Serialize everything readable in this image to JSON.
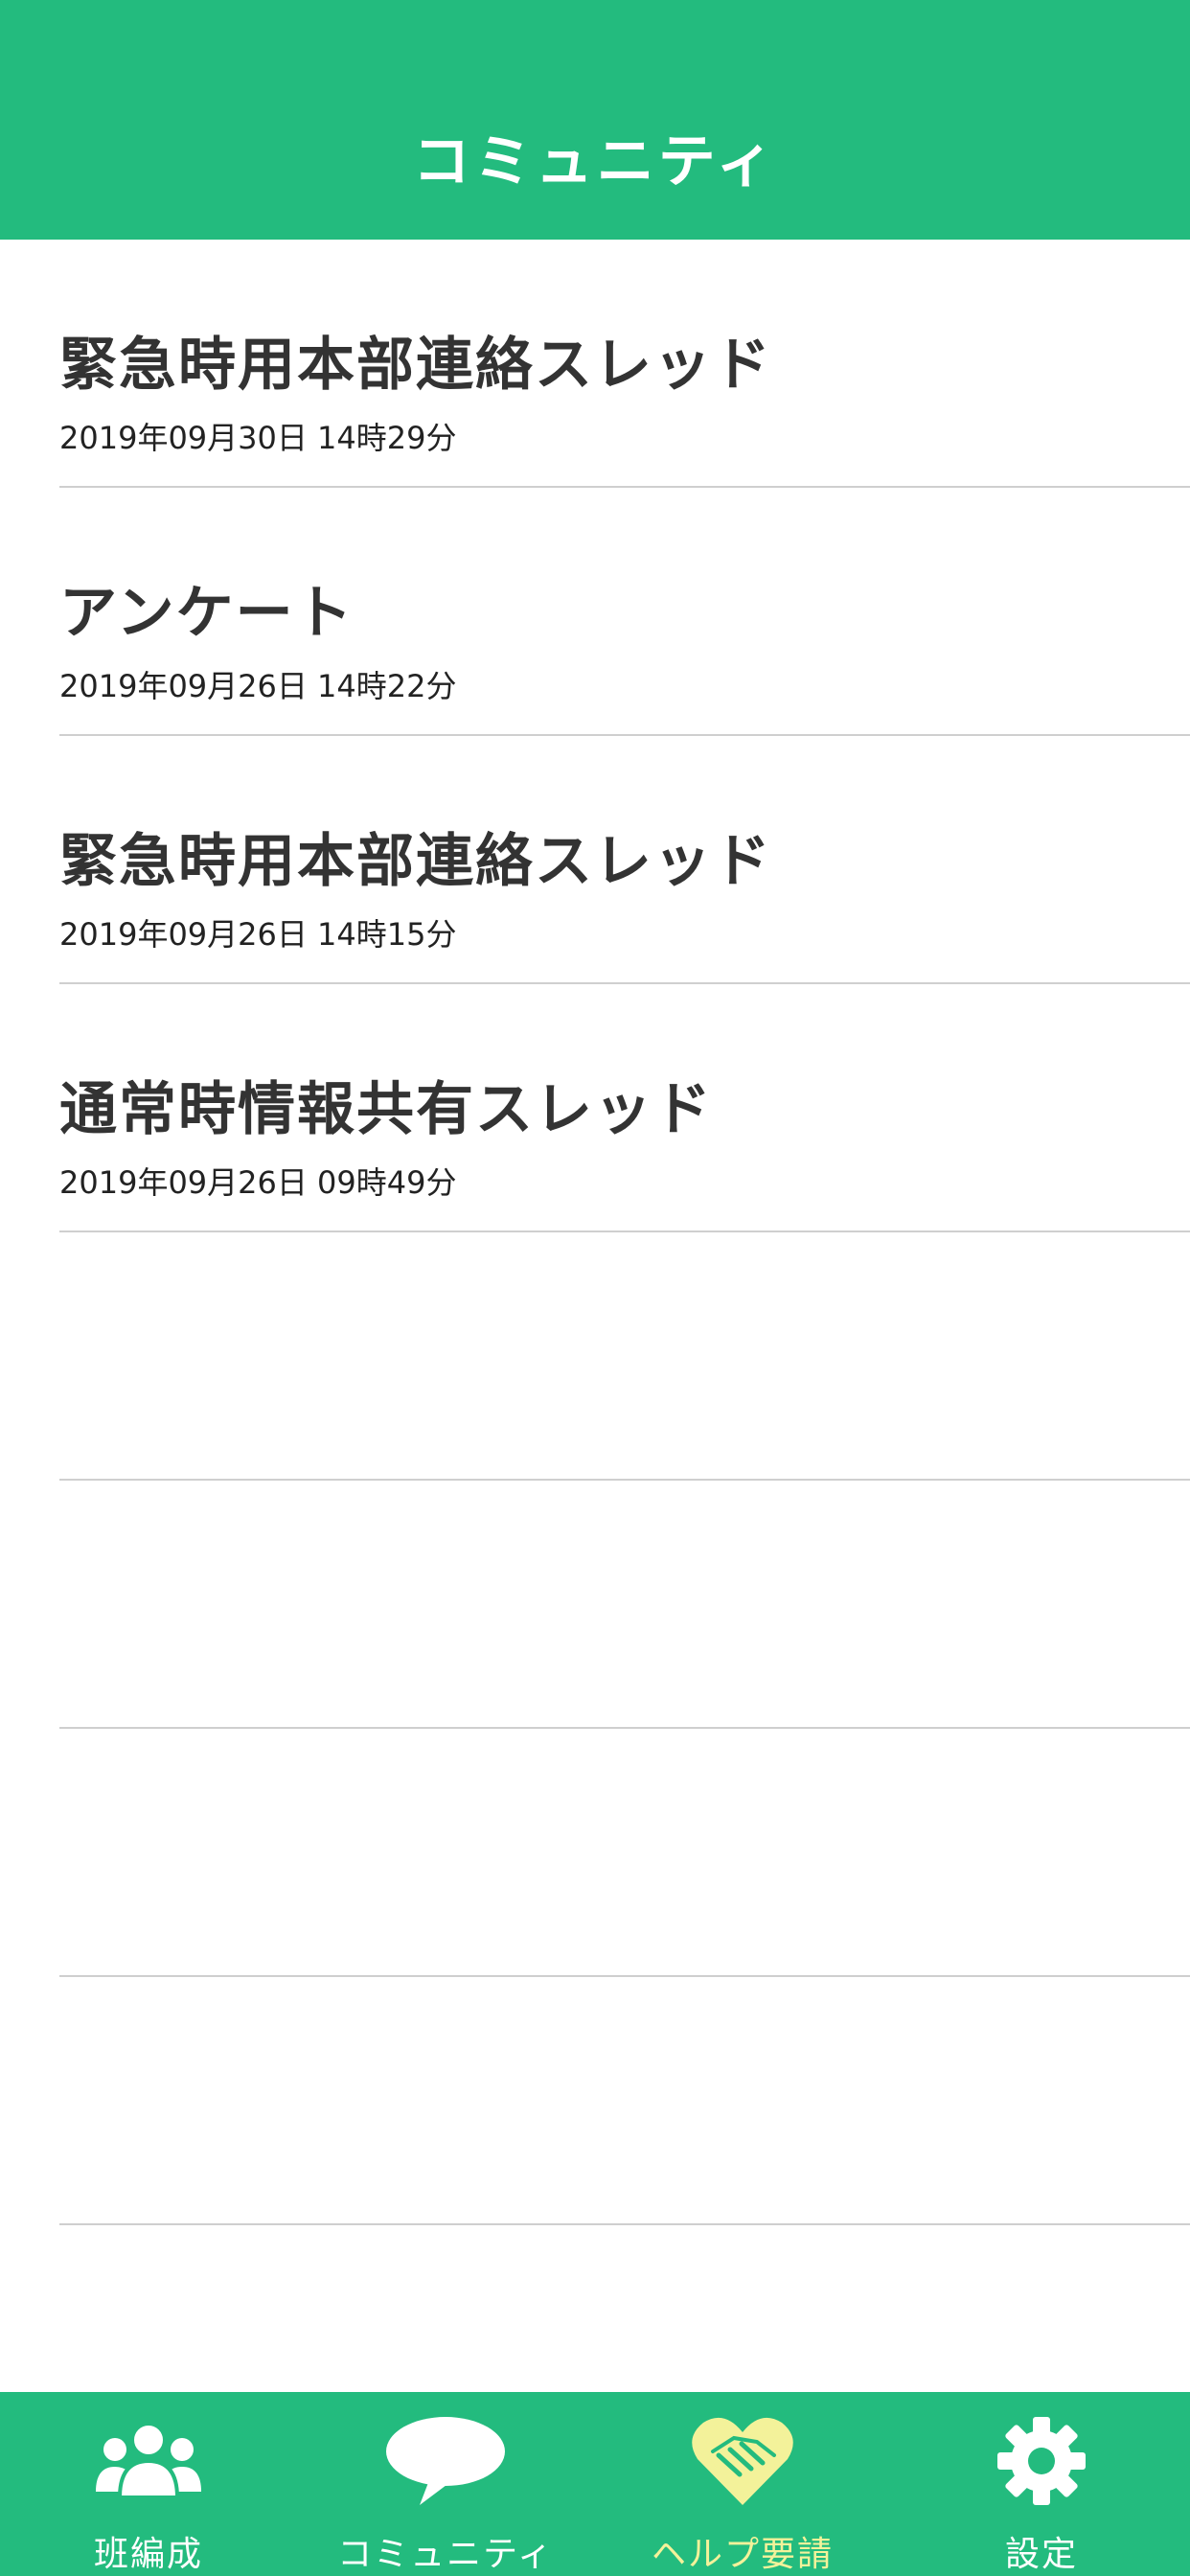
{
  "header": {
    "title": "コミュニティ"
  },
  "threads": [
    {
      "title": "緊急時用本部連絡スレッド",
      "date": "2019年09月30日 14時29分"
    },
    {
      "title": "アンケート",
      "date": "2019年09月26日 14時22分"
    },
    {
      "title": "緊急時用本部連絡スレッド",
      "date": "2019年09月26日 14時15分"
    },
    {
      "title": "通常時情報共有スレッド",
      "date": "2019年09月26日 09時49分"
    },
    {
      "title": "",
      "date": ""
    },
    {
      "title": "",
      "date": ""
    },
    {
      "title": "",
      "date": ""
    },
    {
      "title": "",
      "date": ""
    }
  ],
  "tabs": [
    {
      "label": "班編成",
      "icon": "group-icon"
    },
    {
      "label": "コミュニティ",
      "icon": "chat-bubble-icon"
    },
    {
      "label": "ヘルプ要請",
      "icon": "handshake-heart-icon",
      "active": true
    },
    {
      "label": "設定",
      "icon": "gear-icon"
    }
  ],
  "colors": {
    "brand": "#23bb7e",
    "active_tab": "#f3f29a",
    "divider": "#cfcfcf"
  }
}
